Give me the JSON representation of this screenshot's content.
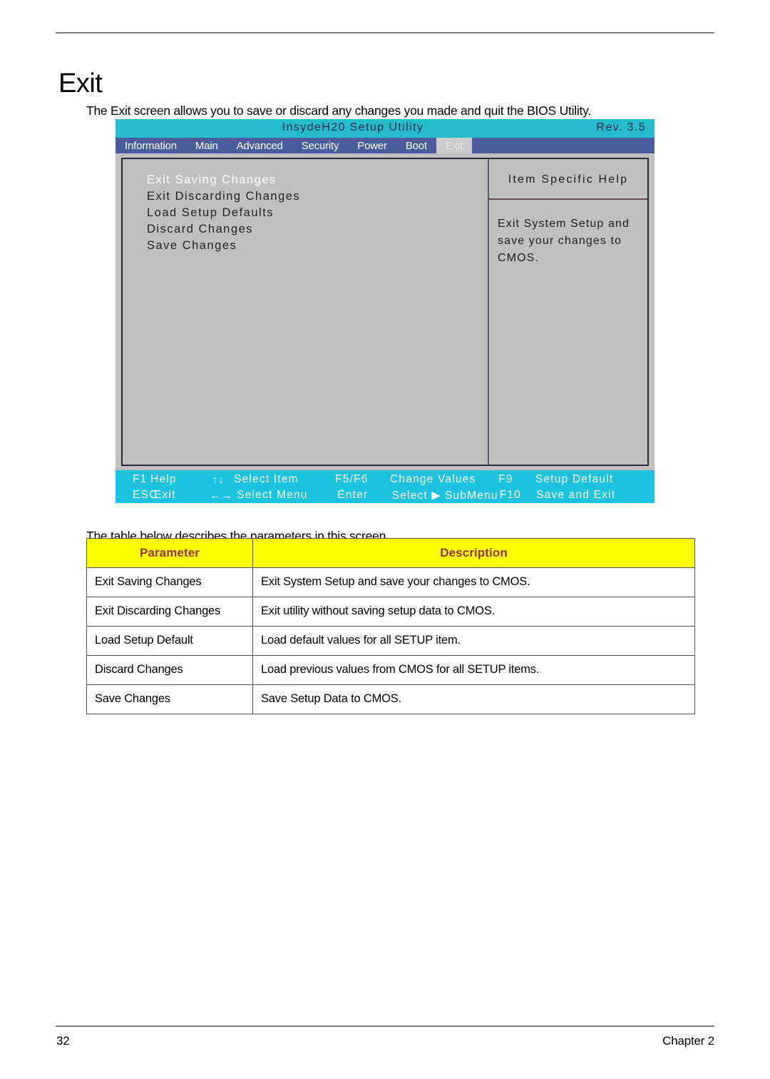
{
  "page": {
    "title": "Exit",
    "intro": "The Exit screen allows you to save or discard any changes you made and quit the BIOS Utility.",
    "table_intro": "The table below describes the parameters in this screen.",
    "footer_page_number": "32",
    "footer_chapter": "Chapter 2"
  },
  "bios": {
    "title": "InsydeH20 Setup Utility",
    "revision": "Rev. 3.5",
    "tabs": [
      {
        "label": "Information",
        "active": false
      },
      {
        "label": "Main",
        "active": false
      },
      {
        "label": "Advanced",
        "active": false
      },
      {
        "label": "Security",
        "active": false
      },
      {
        "label": "Power",
        "active": false
      },
      {
        "label": "Boot",
        "active": false
      },
      {
        "label": "Exit",
        "active": true
      }
    ],
    "menu_items": [
      {
        "label": "Exit Saving Changes",
        "selected": true
      },
      {
        "label": "Exit Discarding Changes",
        "selected": false
      },
      {
        "label": "Load Setup Defaults",
        "selected": false
      },
      {
        "label": "Discard Changes",
        "selected": false
      },
      {
        "label": "Save Changes",
        "selected": false
      }
    ],
    "help": {
      "title": "Item Specific Help",
      "text": "Exit System Setup and save your changes to CMOS."
    },
    "key_hints": {
      "row1": {
        "key1": "F1",
        "label1": "Help",
        "arrow": "↑↓",
        "select": "Select  Item",
        "key2": "F5/F6",
        "action": "Change Values",
        "key3": "F9",
        "action2": "Setup Default"
      },
      "row2": {
        "key1": "ESC",
        "label1": "Exit",
        "arrow": "←→",
        "select": "Select  Menu",
        "key2": "Enter",
        "action": "Select ▶ SubMenu",
        "key3": "F10",
        "action2": "Save and Exit"
      }
    },
    "colors": {
      "title_bar": "#25bccd",
      "menu_bar": "#4a5c9e",
      "footer_bar": "#1cc3de",
      "panel": "#c0c0c0",
      "active_tab": "#cccccc"
    }
  },
  "param_table": {
    "headers": [
      "Parameter",
      "Description"
    ],
    "header_bg": "#ffff00",
    "header_color": "#993333",
    "rows": [
      {
        "parameter": "Exit Saving Changes",
        "description": "Exit System Setup and save your changes to CMOS."
      },
      {
        "parameter": "Exit Discarding Changes",
        "description": "Exit utility without saving setup data to CMOS."
      },
      {
        "parameter": "Load Setup Default",
        "description": "Load default values for all SETUP item."
      },
      {
        "parameter": "Discard Changes",
        "description": "Load previous values from CMOS for all SETUP items."
      },
      {
        "parameter": "Save Changes",
        "description": "Save Setup Data to CMOS."
      }
    ]
  }
}
